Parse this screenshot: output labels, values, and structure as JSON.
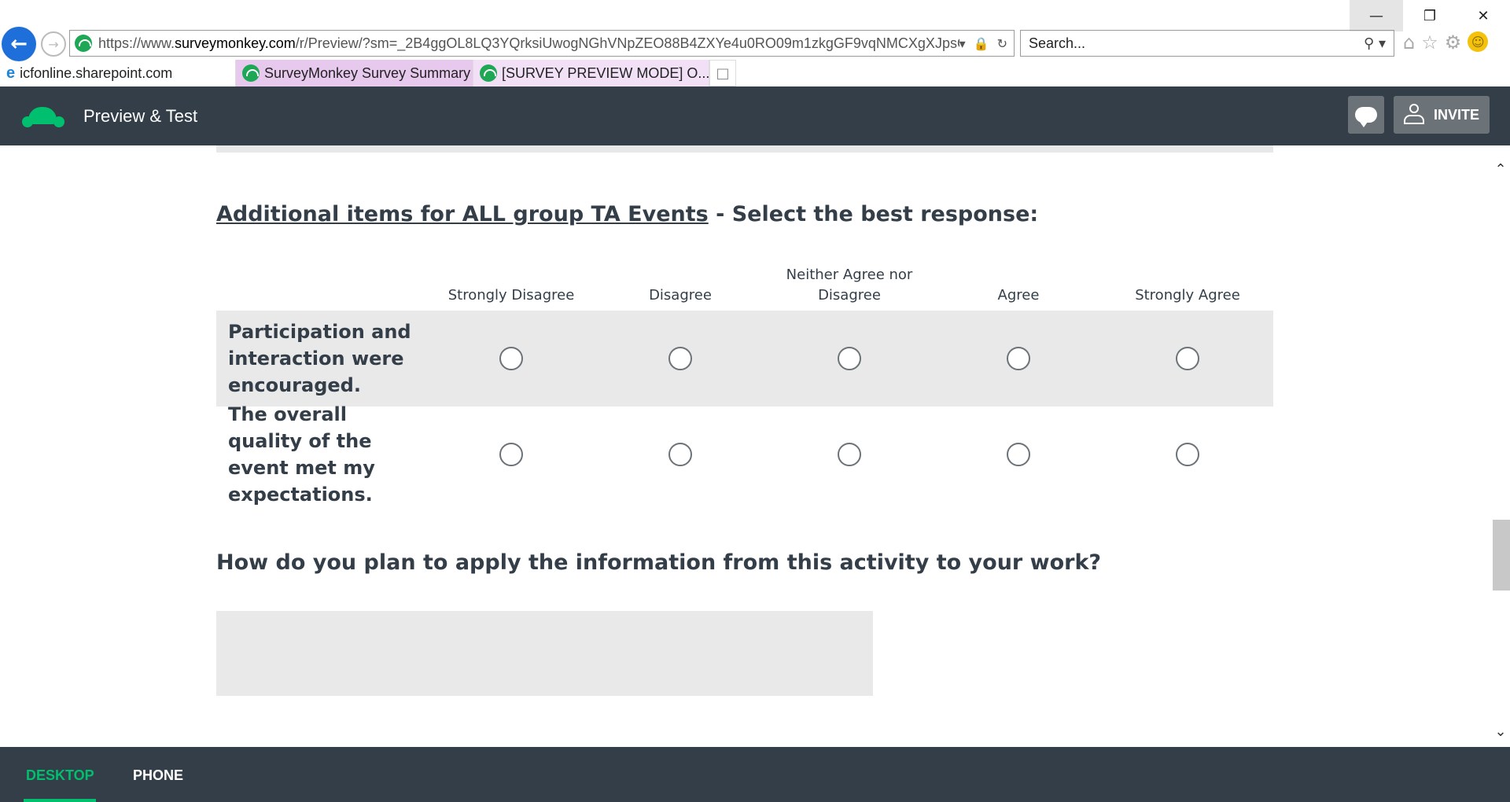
{
  "browser": {
    "url_prefix": "https://www.",
    "url_domain": "surveymonkey.com",
    "url_path": "/r/Preview/?sm=_2B4ggOL8LQ3YQrksiUwogNGhVNpZEO88B4ZXYe4u0RO09m1zkgGF9vqNMCXgXJpsQ",
    "search_placeholder": "Search...",
    "tabs": [
      {
        "label": "icfonline.sharepoint.com"
      },
      {
        "label": "SurveyMonkey Survey Summary"
      },
      {
        "label": "[SURVEY PREVIEW MODE] O..."
      }
    ]
  },
  "app": {
    "title": "Preview & Test",
    "invite_label": "INVITE"
  },
  "question1": {
    "title_underlined": "Additional items for ALL group TA Events",
    "title_rest": " - Select the best response:",
    "columns": [
      "Strongly Disagree",
      "Disagree",
      "Neither Agree nor Disagree",
      "Agree",
      "Strongly Agree"
    ],
    "rows": [
      "Participation and interaction were encouraged.",
      "The overall quality of the event met my expectations."
    ]
  },
  "question2": {
    "title": "How do you plan to apply the information from this activity to your work?"
  },
  "footer": {
    "desktop_label": "DESKTOP",
    "phone_label": "PHONE"
  },
  "colors": {
    "brand_green": "#00bf6f",
    "header_bg": "#333e48"
  }
}
